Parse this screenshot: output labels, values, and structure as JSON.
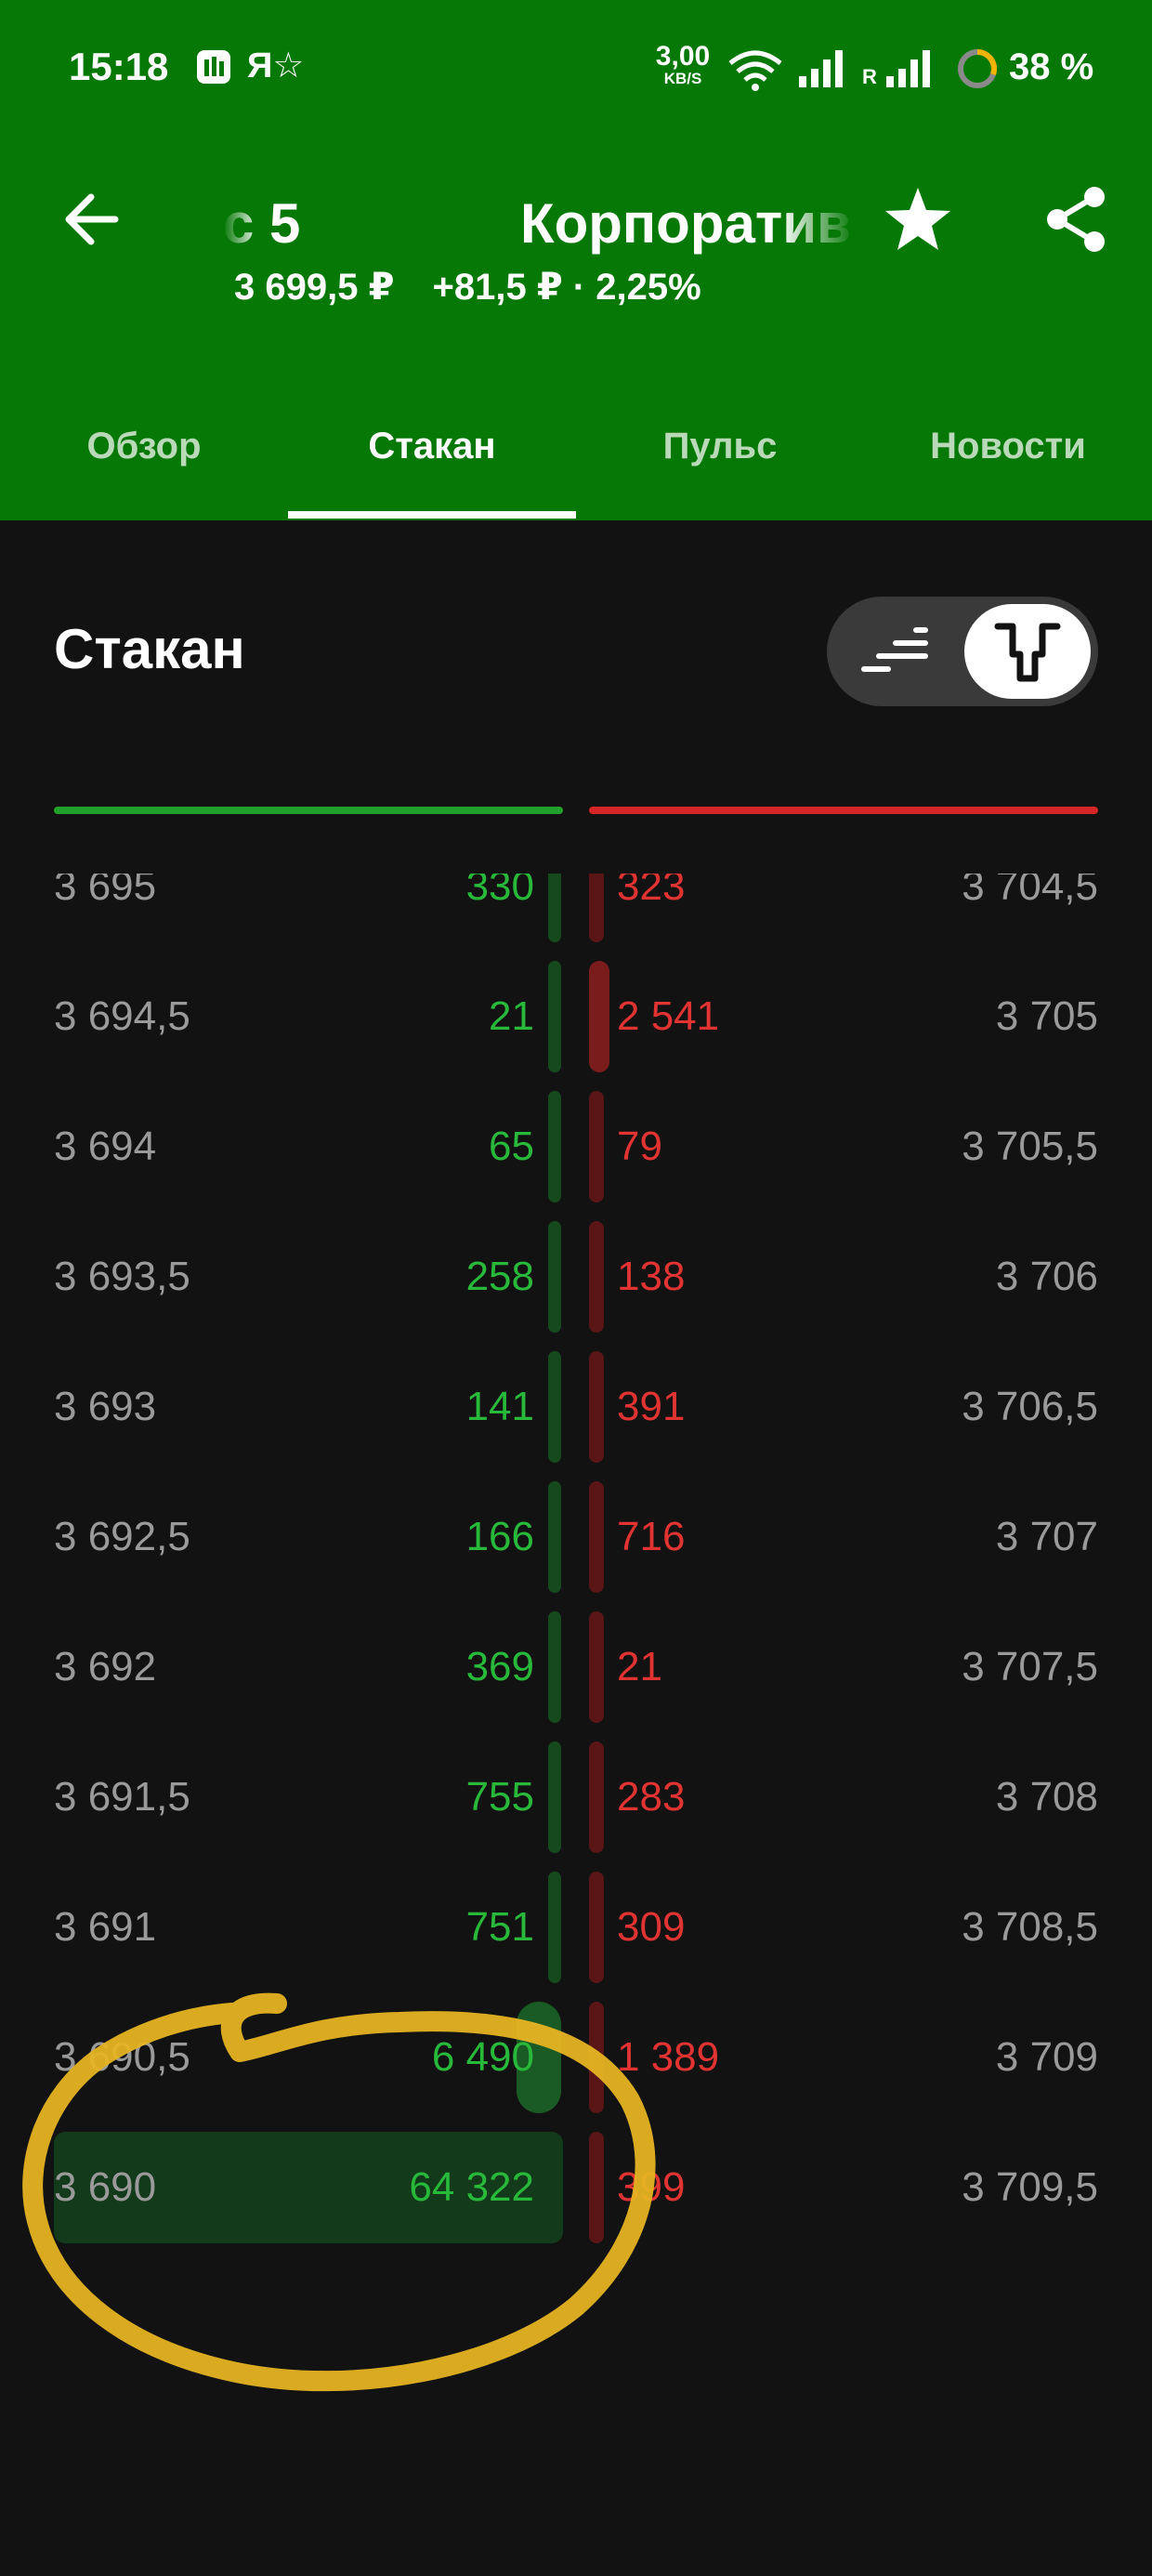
{
  "status_bar": {
    "time": "15:18",
    "app_icon_2": "Я☆",
    "net_speed_value": "3,00",
    "net_speed_unit": "KB/S",
    "roaming": "R",
    "battery": "38 %"
  },
  "header": {
    "title_part1": "с 5",
    "title_part2": "Корпоратив",
    "price": "3 699,5 ₽",
    "change": "+81,5 ₽ · 2,25%",
    "icons": [
      "back-arrow-icon",
      "star-icon",
      "share-icon"
    ],
    "background_color": "#067806"
  },
  "tabs": [
    {
      "label": "Обзор",
      "active": false
    },
    {
      "label": "Стакан",
      "active": true
    },
    {
      "label": "Пульс",
      "active": false
    },
    {
      "label": "Новости",
      "active": false
    }
  ],
  "section": {
    "title": "Стакан",
    "view_toggle": {
      "options": [
        "list-icon",
        "order-book-icon"
      ],
      "selected": "order-book-icon"
    }
  },
  "colors": {
    "bid": "#28b83a",
    "ask": "#e23333",
    "price": "#9a9a9a",
    "annotation": "#f2c12e"
  },
  "order_book": [
    {
      "bid_price": "3 695",
      "bid_qty": "330",
      "ask_qty": "323",
      "ask_price": "3 704,5",
      "ask_level": 0.1,
      "bid_level": 0.1
    },
    {
      "bid_price": "3 694,5",
      "bid_qty": "21",
      "ask_qty": "2 541",
      "ask_price": "3 705",
      "ask_level": 1.0,
      "bid_level": 0.1,
      "ask_highlight": true
    },
    {
      "bid_price": "3 694",
      "bid_qty": "65",
      "ask_qty": "79",
      "ask_price": "3 705,5",
      "ask_level": 0.1,
      "bid_level": 0.1
    },
    {
      "bid_price": "3 693,5",
      "bid_qty": "258",
      "ask_qty": "138",
      "ask_price": "3 706",
      "ask_level": 0.1,
      "bid_level": 0.1
    },
    {
      "bid_price": "3 693",
      "bid_qty": "141",
      "ask_qty": "391",
      "ask_price": "3 706,5",
      "ask_level": 0.1,
      "bid_level": 0.1
    },
    {
      "bid_price": "3 692,5",
      "bid_qty": "166",
      "ask_qty": "716",
      "ask_price": "3 707",
      "ask_level": 0.1,
      "bid_level": 0.1
    },
    {
      "bid_price": "3 692",
      "bid_qty": "369",
      "ask_qty": "21",
      "ask_price": "3 707,5",
      "ask_level": 0.1,
      "bid_level": 0.1
    },
    {
      "bid_price": "3 691,5",
      "bid_qty": "755",
      "ask_qty": "283",
      "ask_price": "3 708",
      "ask_level": 0.1,
      "bid_level": 0.1
    },
    {
      "bid_price": "3 691",
      "bid_qty": "751",
      "ask_qty": "309",
      "ask_price": "3 708,5",
      "ask_level": 0.1,
      "bid_level": 0.1
    },
    {
      "bid_price": "3 690,5",
      "bid_qty": "6 490",
      "ask_qty": "1 389",
      "ask_price": "3 709",
      "ask_level": 0.1,
      "bid_level": 0.1,
      "bid_highlight": true
    },
    {
      "bid_price": "3 690",
      "bid_qty": "64 322",
      "ask_qty": "399",
      "ask_price": "3 709,5",
      "ask_level": 0.1,
      "bid_level": 1.0,
      "bid_big": true
    }
  ]
}
